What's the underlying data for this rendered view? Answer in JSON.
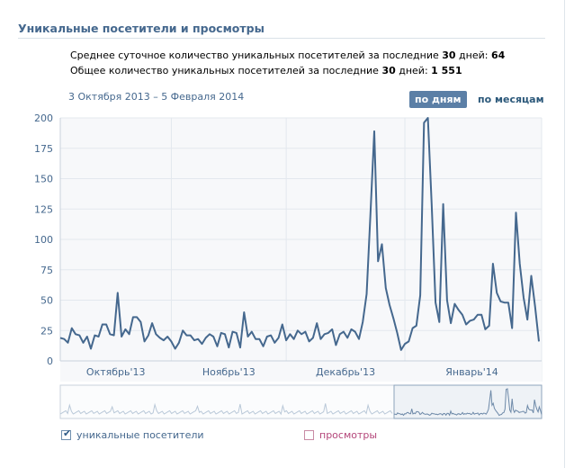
{
  "header": {
    "title": "Уникальные посетители и просмотры"
  },
  "stats": {
    "line1_prefix": "Среднее суточное количество уникальных посетителей за последние ",
    "line1_days": "30",
    "line1_mid": " дней: ",
    "line1_value": "64",
    "line2_prefix": "Общее количество уникальных посетителей за последние ",
    "line2_days": "30",
    "line2_mid": " дней: ",
    "line2_value": "1 551"
  },
  "period": {
    "range": "3 Октября 2013 – 5 Февраля 2014",
    "by_days": "по дням",
    "by_months": "по месяцам"
  },
  "legend": {
    "unique_visitors": "уникальные посетители",
    "views": "просмотры"
  },
  "colors": {
    "line": "#45688e",
    "accent": "#5b7fa6",
    "grid": "#e3e8ee",
    "views": "#b4467a"
  },
  "chart_data": {
    "type": "line",
    "x_range": [
      "2013-10-03",
      "2014-02-05"
    ],
    "ylim": [
      0,
      200
    ],
    "yticks": [
      0,
      25,
      50,
      75,
      100,
      125,
      150,
      175,
      200
    ],
    "month_labels": [
      "Октябрь'13",
      "Ноябрь'13",
      "Декабрь'13",
      "Январь'14"
    ],
    "grid": true,
    "series": [
      {
        "name": "уникальные посетители",
        "checked": true,
        "values": [
          19,
          18,
          15,
          27,
          22,
          21,
          15,
          20,
          10,
          21,
          20,
          30,
          30,
          22,
          21,
          56,
          20,
          26,
          22,
          36,
          36,
          32,
          16,
          21,
          31,
          22,
          19,
          17,
          20,
          16,
          10,
          15,
          25,
          21,
          21,
          17,
          18,
          14,
          19,
          22,
          20,
          12,
          23,
          22,
          11,
          24,
          23,
          11,
          40,
          20,
          24,
          18,
          18,
          12,
          20,
          21,
          15,
          19,
          30,
          17,
          22,
          18,
          25,
          22,
          24,
          16,
          19,
          31,
          18,
          22,
          23,
          26,
          13,
          22,
          24,
          19,
          26,
          24,
          18,
          32,
          55,
          120,
          189,
          82,
          96,
          60,
          46,
          35,
          23,
          9,
          14,
          16,
          27,
          29,
          54,
          196,
          200,
          129,
          48,
          32,
          129,
          50,
          31,
          47,
          42,
          38,
          30,
          33,
          34,
          38,
          38,
          26,
          29,
          80,
          56,
          49,
          48,
          48,
          27,
          122,
          80,
          52,
          34,
          70,
          45,
          16
        ],
        "extended": [
          48,
          45,
          38,
          42,
          38,
          28,
          25,
          20,
          16
        ]
      },
      {
        "name": "просмотры",
        "checked": false,
        "values": []
      }
    ]
  }
}
